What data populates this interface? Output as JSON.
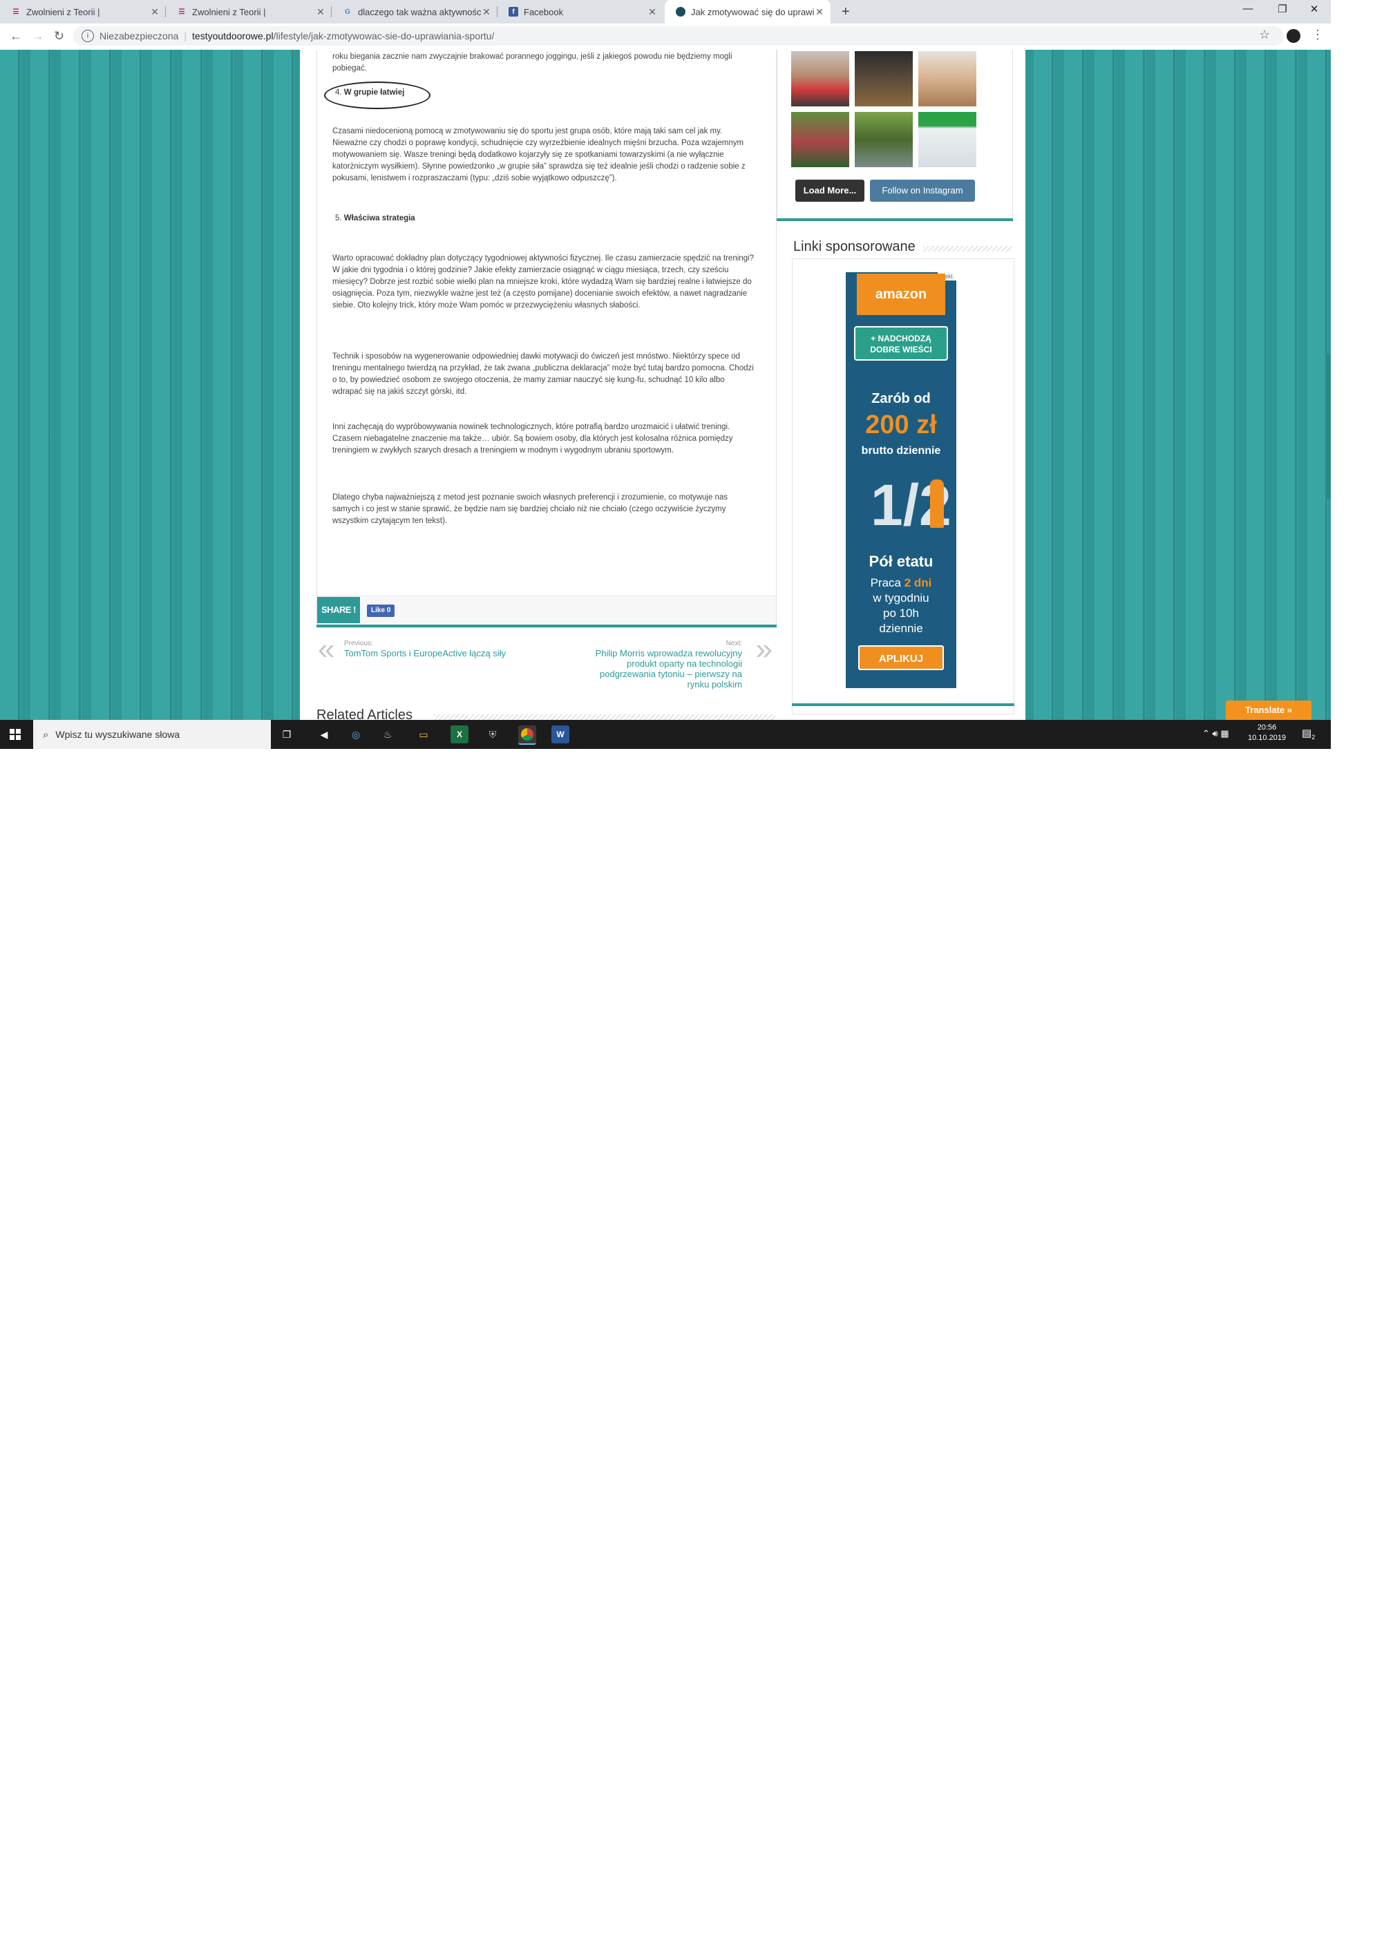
{
  "browser": {
    "tabs": [
      {
        "title": "Zwolnieni z Teorii |",
        "favicon": "zzt"
      },
      {
        "title": "Zwolnieni z Teorii |",
        "favicon": "zzt"
      },
      {
        "title": "dlaczego tak ważna aktywności fi…",
        "favicon": "G"
      },
      {
        "title": "Facebook",
        "favicon": "f"
      },
      {
        "title": "Jak zmotywować się do uprawian…",
        "favicon": "site"
      }
    ],
    "new_tab": "+",
    "window_controls": {
      "minimize": "—",
      "restore": "❐",
      "close": "✕"
    },
    "security_label": "Niezabezpieczona",
    "url_host": "testyoutdoorowe.pl",
    "url_path": "/lifestyle/jak-zmotywowac-sie-do-uprawiania-sportu/"
  },
  "article": {
    "intro_tail": "roku biegania zacznie nam zwyczajnie brakować porannego joggingu, jeśli z jakiegoś powodu nie będziemy mogli pobiegać.",
    "item4_number": "4.",
    "item4_label": "W grupie łatwiej",
    "para_group": "Czasami niedocenioną pomocą w zmotywowaniu się do sportu jest grupa osób, które mają taki sam cel jak my. Nieważne czy chodzi o poprawę kondycji, schudnięcie czy wyrzeźbienie idealnych mięśni brzucha. Poza wzajemnym motywowaniem się. Wasze treningi będą dodatkowo kojarzyły się ze spotkaniami towarzyskimi (a nie wyłącznie katorżniczym wysiłkiem). Słynne powiedzonko „w grupie siła” sprawdza się też idealnie jeśli chodzi o radzenie sobie z pokusami, lenistwem i rozpraszaczami (typu: „dziś sobie wyjątkowo odpuszczę”).",
    "item5_number": "5.",
    "item5_label": "Właściwa strategia",
    "para_strategy": "Warto opracować dokładny plan dotyczący tygodniowej aktywności fizycznej. Ile czasu zamierzacie spędzić na treningi? W jakie dni tygodnia i o której godzinie? Jakie efekty zamierzacie osiągnąć w ciągu miesiąca, trzech, czy sześciu miesięcy? Dobrze jest rozbić sobie wielki plan na mniejsze kroki, które wydadzą Wam się bardziej realne i łatwiejsze do osiągnięcia. Poza tym, niezwykle ważne jest też (a często pomijane) docenianie swoich efektów, a nawet nagradzanie siebie. Oto kolejny trick, który może Wam pomóc w przezwyciężeniu własnych słabości.",
    "para_techniques": "Technik i sposobów na wygenerowanie odpowiedniej dawki motywacji do ćwiczeń jest mnóstwo. Niektórzy spece od treningu mentalnego twierdzą na przykład, że tak zwana „publiczna deklaracja” może być tutaj bardzo pomocna. Chodzi o to, by powiedzieć osobom ze swojego otoczenia, że mamy zamiar nauczyć się kung-fu, schudnąć 10 kilo albo wdrapać się na jakiś szczyt górski, itd.",
    "para_gadgets": "Inni zachęcają do wypróbowywania nowinek technologicznych, które potrafią bardzo urozmaicić i ułatwić treningi. Czasem niebagatelne znaczenie ma także… ubiór. Są bowiem osoby, dla których jest kolosalna różnica pomiędzy treningiem w zwykłych szarych dresach a treningiem w modnym i wygodnym ubraniu sportowym.",
    "para_final": "Dlatego chyba najważniejszą z metod jest poznanie swoich własnych preferencji i zrozumienie, co motywuje nas samych i co jest w stanie sprawić, że będzie nam się bardziej chciało niż nie chciało (czego oczywiście życzymy wszystkim czytającym ten tekst).",
    "share_label": "SHARE !",
    "like_label": "Like 0"
  },
  "post_nav": {
    "prev_label": "Previous:",
    "prev_title": "TomTom Sports i EuropeActive łączą siły",
    "next_label": "Next:",
    "next_title": "Philip Morris wprowadza rewolucyjny produkt oparty na technologii podgrzewania tytoniu – pierwszy na rynku polskim",
    "prev_chevron": "«",
    "next_chevron": "»"
  },
  "related_title": "Related Articles",
  "sidebar": {
    "load_more": "Load More...",
    "follow_instagram": "Follow on Instagram",
    "sponsored_title": "Linki sponsorowane",
    "ad": {
      "reklama": "Rekl.",
      "brand": "amazon",
      "bubble": "+ NADCHODZĄ DOBRE WIEŚCI",
      "earn": "Zarób od",
      "amount": "200 zł",
      "per_day": "brutto dziennie",
      "half": "1/2",
      "half_time": "Pół etatu",
      "work_line1": "Praca",
      "work_days": "2 dni",
      "work_line2": "w tygodniu",
      "work_line3": "po 10h",
      "work_line4": "dziennie",
      "apply": "APLIKUJ"
    }
  },
  "translate_label": "Translate »",
  "taskbar": {
    "search_placeholder": "Wpisz tu wyszukiwane słowa",
    "time": "20:56",
    "date": "10.10.2019",
    "notification_count": "2"
  },
  "colors": {
    "teal": "#2d9a98",
    "amazon_orange": "#f08f1f",
    "ad_blue": "#1d5c80"
  }
}
